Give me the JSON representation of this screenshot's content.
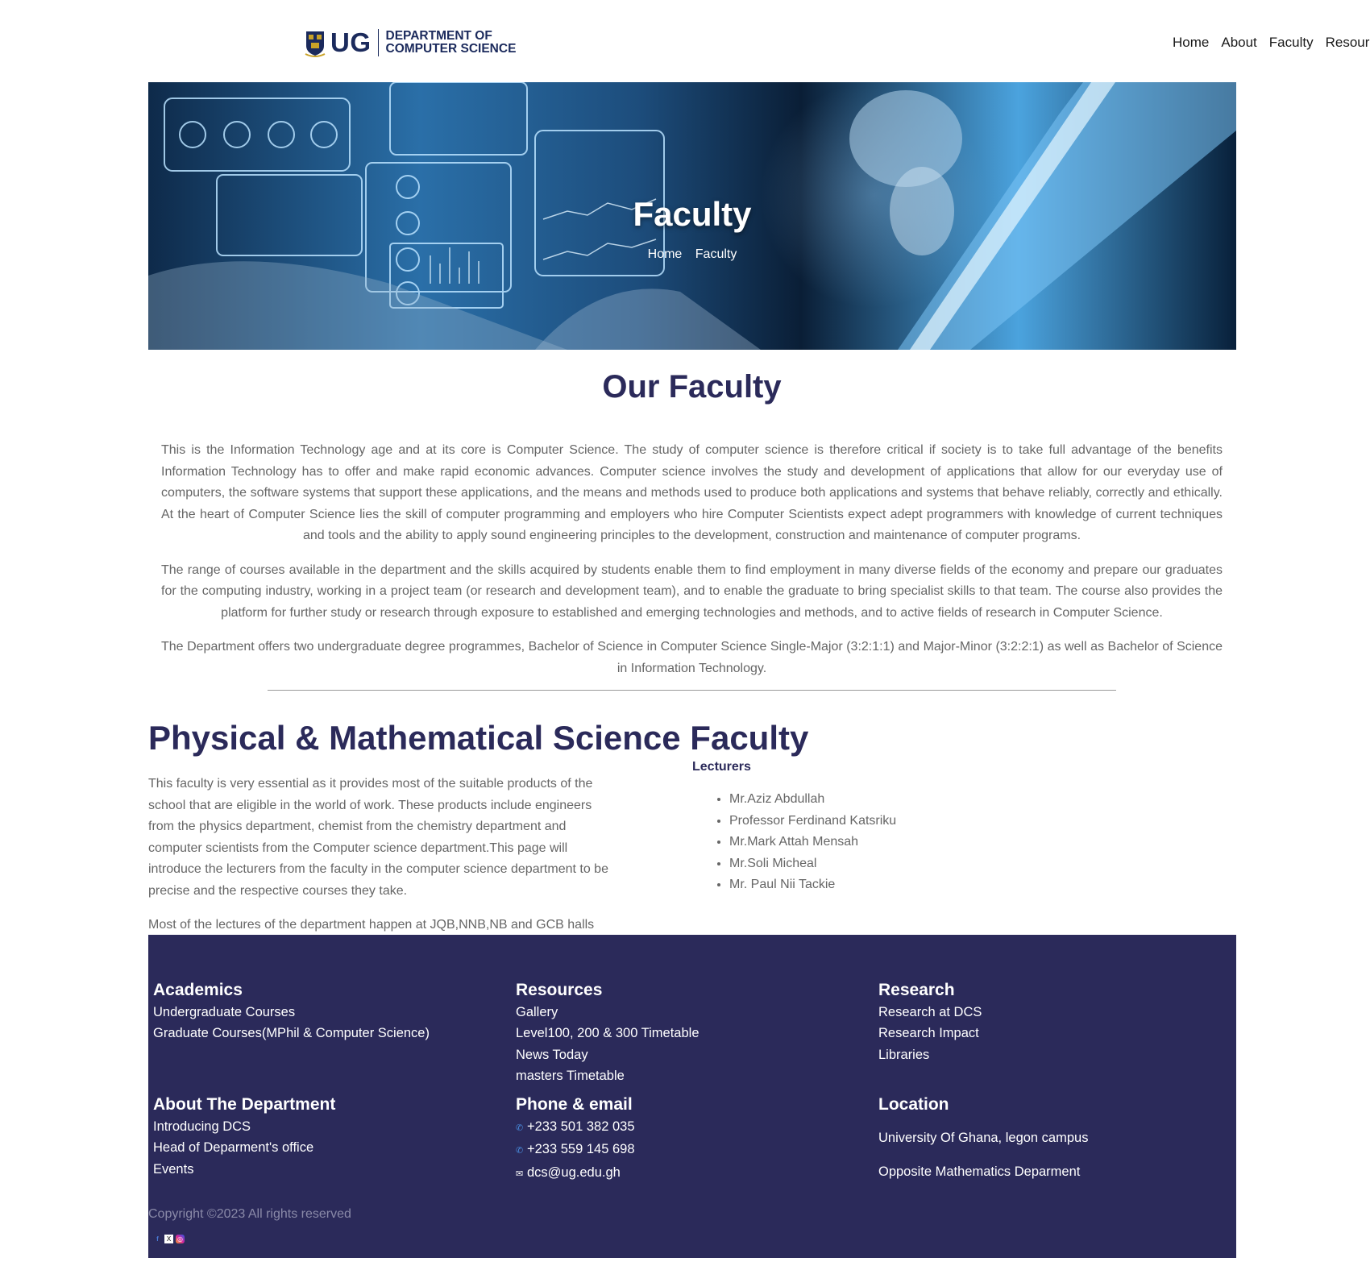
{
  "header": {
    "logo_ug": "UG",
    "logo_dept_line1": "DEPARTMENT OF",
    "logo_dept_line2": "COMPUTER SCIENCE",
    "nav": [
      "Home",
      "About",
      "Faculty",
      "Resources"
    ]
  },
  "hero": {
    "title": "Faculty",
    "breadcrumb_home": "Home",
    "breadcrumb_current": "Faculty"
  },
  "about": {
    "title": "Our Faculty",
    "paragraphs": [
      "This is the Information Technology age and at its core is Computer Science. The study of computer science is therefore critical if society is to take full advantage of the benefits Information Technology has to offer and make rapid economic advances. Computer science involves the study and development of applications that allow for our everyday use of computers, the software systems that support these applications, and the means and methods used to produce both applications and systems that behave reliably, correctly and ethically. At the heart of Computer Science lies the skill of computer programming and employers who hire Computer Scientists expect adept programmers with knowledge of current techniques and tools and the ability to apply sound engineering principles to the development, construction and maintenance of computer programs.",
      "The range of courses available in the department and the skills acquired by students enable them to find employment in many diverse fields of the economy and prepare our graduates for the computing industry, working in a project team (or research and development team), and to enable the graduate to bring specialist skills to that team. The course also provides the platform for further study or research through exposure to established and emerging technologies and methods, and to active fields of research in Computer Science.",
      "The Department offers two undergraduate degree programmes, Bachelor of Science in Computer Science Single-Major (3:2:1:1) and Major-Minor (3:2:2:1) as well as Bachelor of Science in Information Technology."
    ]
  },
  "faculty": {
    "title": "Physical & Mathematical Science Faculty",
    "description": "This faculty is very essential as it provides most of the suitable products of the school that are eligible in the world of work. These products include engineers from the physics department, chemist from the chemistry department and computer scientists from the Computer science department.This page will introduce the lecturers from the faculty in the computer science department to be precise and the respective courses they take.",
    "halls_note": "Most of the lectures of the department happen at JQB,NNB,NB and GCB halls",
    "lecturers_heading": "Lecturers",
    "lecturers": [
      "Mr.Aziz Abdullah",
      "Professor Ferdinand Katsriku",
      "Mr.Mark Attah Mensah",
      "Mr.Soli Micheal",
      "Mr. Paul Nii Tackie"
    ]
  },
  "footer": {
    "academics": {
      "heading": "Academics",
      "links": [
        "Undergraduate Courses",
        "Graduate Courses(MPhil & Computer Science)"
      ]
    },
    "resources": {
      "heading": "Resources",
      "links": [
        "Gallery",
        "Level100, 200 & 300 Timetable",
        "News Today",
        "masters Timetable"
      ]
    },
    "research": {
      "heading": "Research",
      "links": [
        "Research at DCS",
        "Research Impact",
        "Libraries"
      ]
    },
    "about_dept": {
      "heading": "About The Department",
      "links": [
        "Introducing DCS",
        "Head of Deparment's office",
        "Events"
      ]
    },
    "contact": {
      "heading": "Phone & email",
      "phone1": "+233 501 382 035",
      "phone2": "+233 559 145 698",
      "email": "dcs@ug.edu.gh"
    },
    "location": {
      "heading": "Location",
      "line1": "University Of Ghana, legon campus",
      "line2": "Opposite Mathematics Deparment"
    },
    "copyright": "Copyright ©2023 All rights reserved",
    "social_icons": [
      "facebook-icon",
      "x-icon",
      "instagram-icon"
    ]
  },
  "colors": {
    "brand_navy": "#2b2a5a",
    "logo_blue": "#1b2a5c"
  }
}
